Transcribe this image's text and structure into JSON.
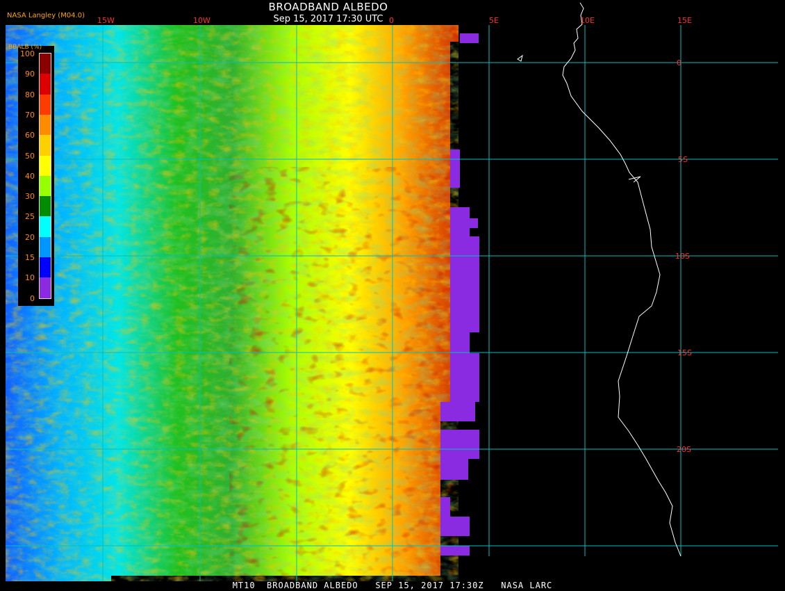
{
  "header": {
    "title": "BROADBAND ALBEDO",
    "datetime": "Sep 15, 2017 17:30 UTC",
    "credit": "NASA Langley (M04.0)"
  },
  "footer": {
    "text": "MT10  BROADBAND ALBEDO   SEP 15, 2017 17:30Z   NASA LARC"
  },
  "legend": {
    "title": "BBALB (%)",
    "labels": [
      "100",
      "90",
      "80",
      "70",
      "60",
      "50",
      "40",
      "30",
      "25",
      "20",
      "15",
      "10",
      "0"
    ],
    "colors": [
      "#8b0000",
      "#dc0000",
      "#ff3c00",
      "#ff8c00",
      "#ffd000",
      "#ffff00",
      "#96ff00",
      "#008c00",
      "#00ffff",
      "#0096ff",
      "#0000ff",
      "#8a2be2"
    ]
  },
  "grid": {
    "longitude_labels": [
      "15W",
      "10W",
      "0",
      "5E",
      "10E",
      "15E"
    ],
    "latitude_labels": [
      "0",
      "5S",
      "10S",
      "15S",
      "20S"
    ],
    "line_color": "#00c0c0",
    "label_color": "#ff3030"
  },
  "colors": {
    "no_data": "#8a2be2",
    "coastline": "#ffffff",
    "background": "#000000"
  }
}
